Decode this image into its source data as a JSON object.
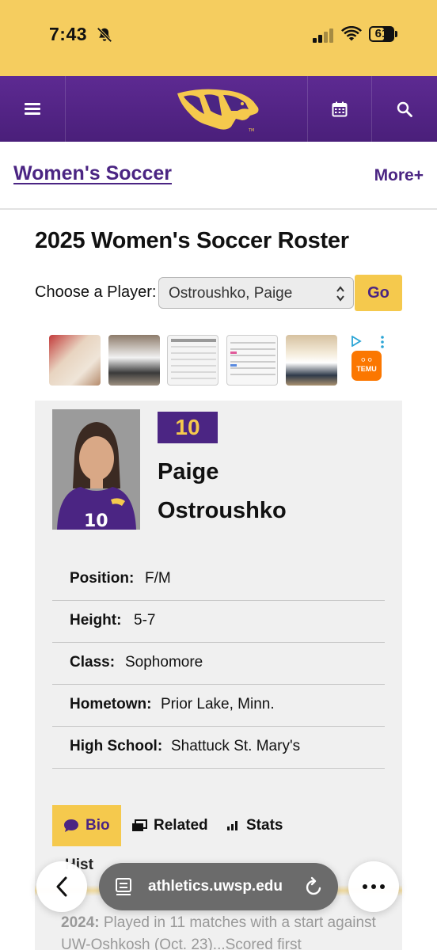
{
  "status_bar": {
    "time": "7:43",
    "battery": "61"
  },
  "header": {
    "logo_alt": "UWSP Pointer logo",
    "icons": [
      "hamburger-menu-icon",
      "calendar-icon",
      "search-icon"
    ]
  },
  "subnav": {
    "sport": "Women's Soccer",
    "more": "More+"
  },
  "roster": {
    "title": "2025 Women's Soccer Roster",
    "choose_label": "Choose a Player:",
    "selected_player": "Ostroushko, Paige",
    "go_label": "Go"
  },
  "ad": {
    "brand": "TEMU"
  },
  "player": {
    "number": "10",
    "first_name": "Paige",
    "last_name": "Ostroushko",
    "details": [
      {
        "label": "Position:",
        "value": "F/M"
      },
      {
        "label": "Height:",
        "value": "5-7"
      },
      {
        "label": "Class:",
        "value": "Sophomore"
      },
      {
        "label": "Hometown:",
        "value": "Prior Lake, Minn."
      },
      {
        "label": "High School:",
        "value": "Shattuck St. Mary's"
      }
    ]
  },
  "tabs": [
    {
      "label": "Bio",
      "active": true
    },
    {
      "label": "Related",
      "active": false
    },
    {
      "label": "Stats",
      "active": false
    }
  ],
  "bio": {
    "section_peek": "Hist",
    "year": "2024:",
    "text": " Played in 11 matches with a start against UW-Oshkosh (Oct. 23)...Scored first"
  },
  "browser": {
    "url": "athletics.uwsp.edu"
  },
  "colors": {
    "purple": "#4b2583",
    "gold": "#f5c94d",
    "status_yellow": "#f5cd5f"
  }
}
